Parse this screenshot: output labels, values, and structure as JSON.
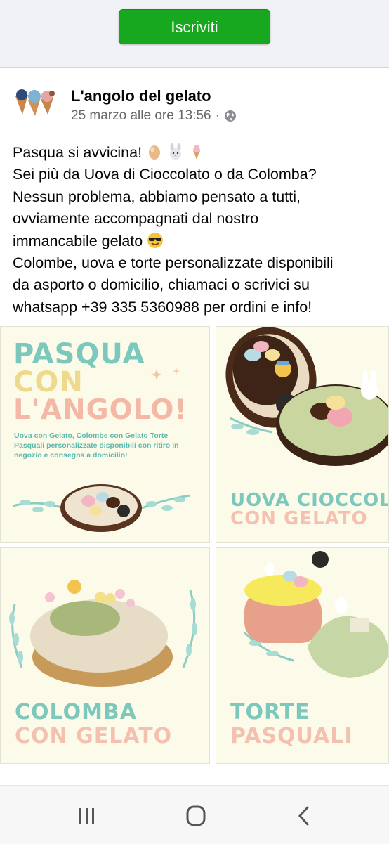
{
  "subscribe": {
    "label": "Iscriviti"
  },
  "post": {
    "author": "L'angolo del gelato",
    "timestamp": "25 marzo alle ore 13:56",
    "separator": "·",
    "text_lines": [
      "Pasqua si avvicina!",
      "Sei più da Uova di Cioccolato o da Colomba?",
      "Nessun problema, abbiamo pensato a tutti,",
      "ovviamente accompagnati dal nostro",
      "immancabile gelato",
      "Colombe, uova e torte personalizzate disponibili",
      "da asporto o domicilio, chiamaci o scrivici su",
      "whatsapp +39 335 5360988 per ordini e info!"
    ],
    "emojis": [
      "egg-emoji",
      "rabbit-emoji",
      "ice-cream-emoji",
      "sunglasses-emoji"
    ]
  },
  "gallery": {
    "tile1": {
      "line1": "PASQUA",
      "line2": "CON",
      "line3": "L'ANGOLO!",
      "description": "Uova con Gelato, Colombe con Gelato Torte Pasquali personalizzate disponibili con ritiro in negozio e consegna a domicilio!"
    },
    "tile2": {
      "title_a": "UOVA CIOCCOLATO",
      "title_b": "CON GELATO"
    },
    "tile3": {
      "title_a": "COLOMBA",
      "title_b": "CON GELATO"
    },
    "tile4": {
      "title_a": "TORTE",
      "title_b": "PASQUALI"
    }
  },
  "colors": {
    "subscribe_green": "#17a81f",
    "tile_bg": "#fcfbea",
    "teal": "#7cc8bd",
    "yellow": "#efd98c",
    "peach": "#f4b9a6"
  },
  "navbar": {
    "icons": [
      "recent-apps-icon",
      "home-icon",
      "back-icon"
    ]
  }
}
